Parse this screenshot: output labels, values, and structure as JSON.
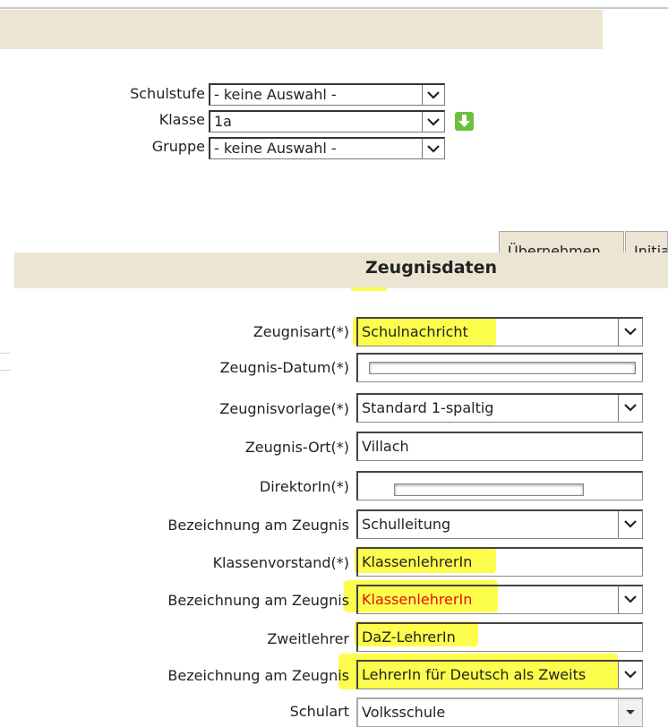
{
  "filter": {
    "schulstufe": {
      "label": "Schulstufe",
      "value": "- keine Auswahl -"
    },
    "klasse": {
      "label": "Klasse",
      "value": "1a"
    },
    "gruppe": {
      "label": "Gruppe",
      "value": "- keine Auswahl -"
    }
  },
  "actions": {
    "uebernehmen": "Übernehmen",
    "initialisieren": "Initia"
  },
  "section_title": "Zeugnisdaten",
  "form": [
    {
      "label": "Zeugnisart(*)",
      "value": "Schulnachricht",
      "type": "select"
    },
    {
      "label": "Zeugnis-Datum(*)",
      "value": "",
      "type": "redacted"
    },
    {
      "label": "Zeugnisvorlage(*)",
      "value": "Standard 1-spaltig",
      "type": "select"
    },
    {
      "label": "Zeugnis-Ort(*)",
      "value": "Villach",
      "type": "text"
    },
    {
      "label": "DirektorIn(*)",
      "value": "",
      "type": "redacted"
    },
    {
      "label": "Bezeichnung am Zeugnis",
      "value": "Schulleitung",
      "type": "select"
    },
    {
      "label": "Klassenvorstand(*)",
      "value": "KlassenlehrerIn",
      "type": "text"
    },
    {
      "label": "Bezeichnung am Zeugnis",
      "value": "KlassenlehrerIn",
      "type": "select"
    },
    {
      "label": "Zweitlehrer",
      "value": "DaZ-LehrerIn",
      "type": "text"
    },
    {
      "label": "Bezeichnung am Zeugnis",
      "value": "LehrerIn für Deutsch als Zweits",
      "type": "select"
    },
    {
      "label": "Schulart",
      "value": "Volksschule",
      "type": "select"
    }
  ],
  "colors": {
    "band": "#ece5d3",
    "highlight": "#fdfd3a",
    "red_text": "#e01010",
    "green_button": "#6bbf3a"
  }
}
